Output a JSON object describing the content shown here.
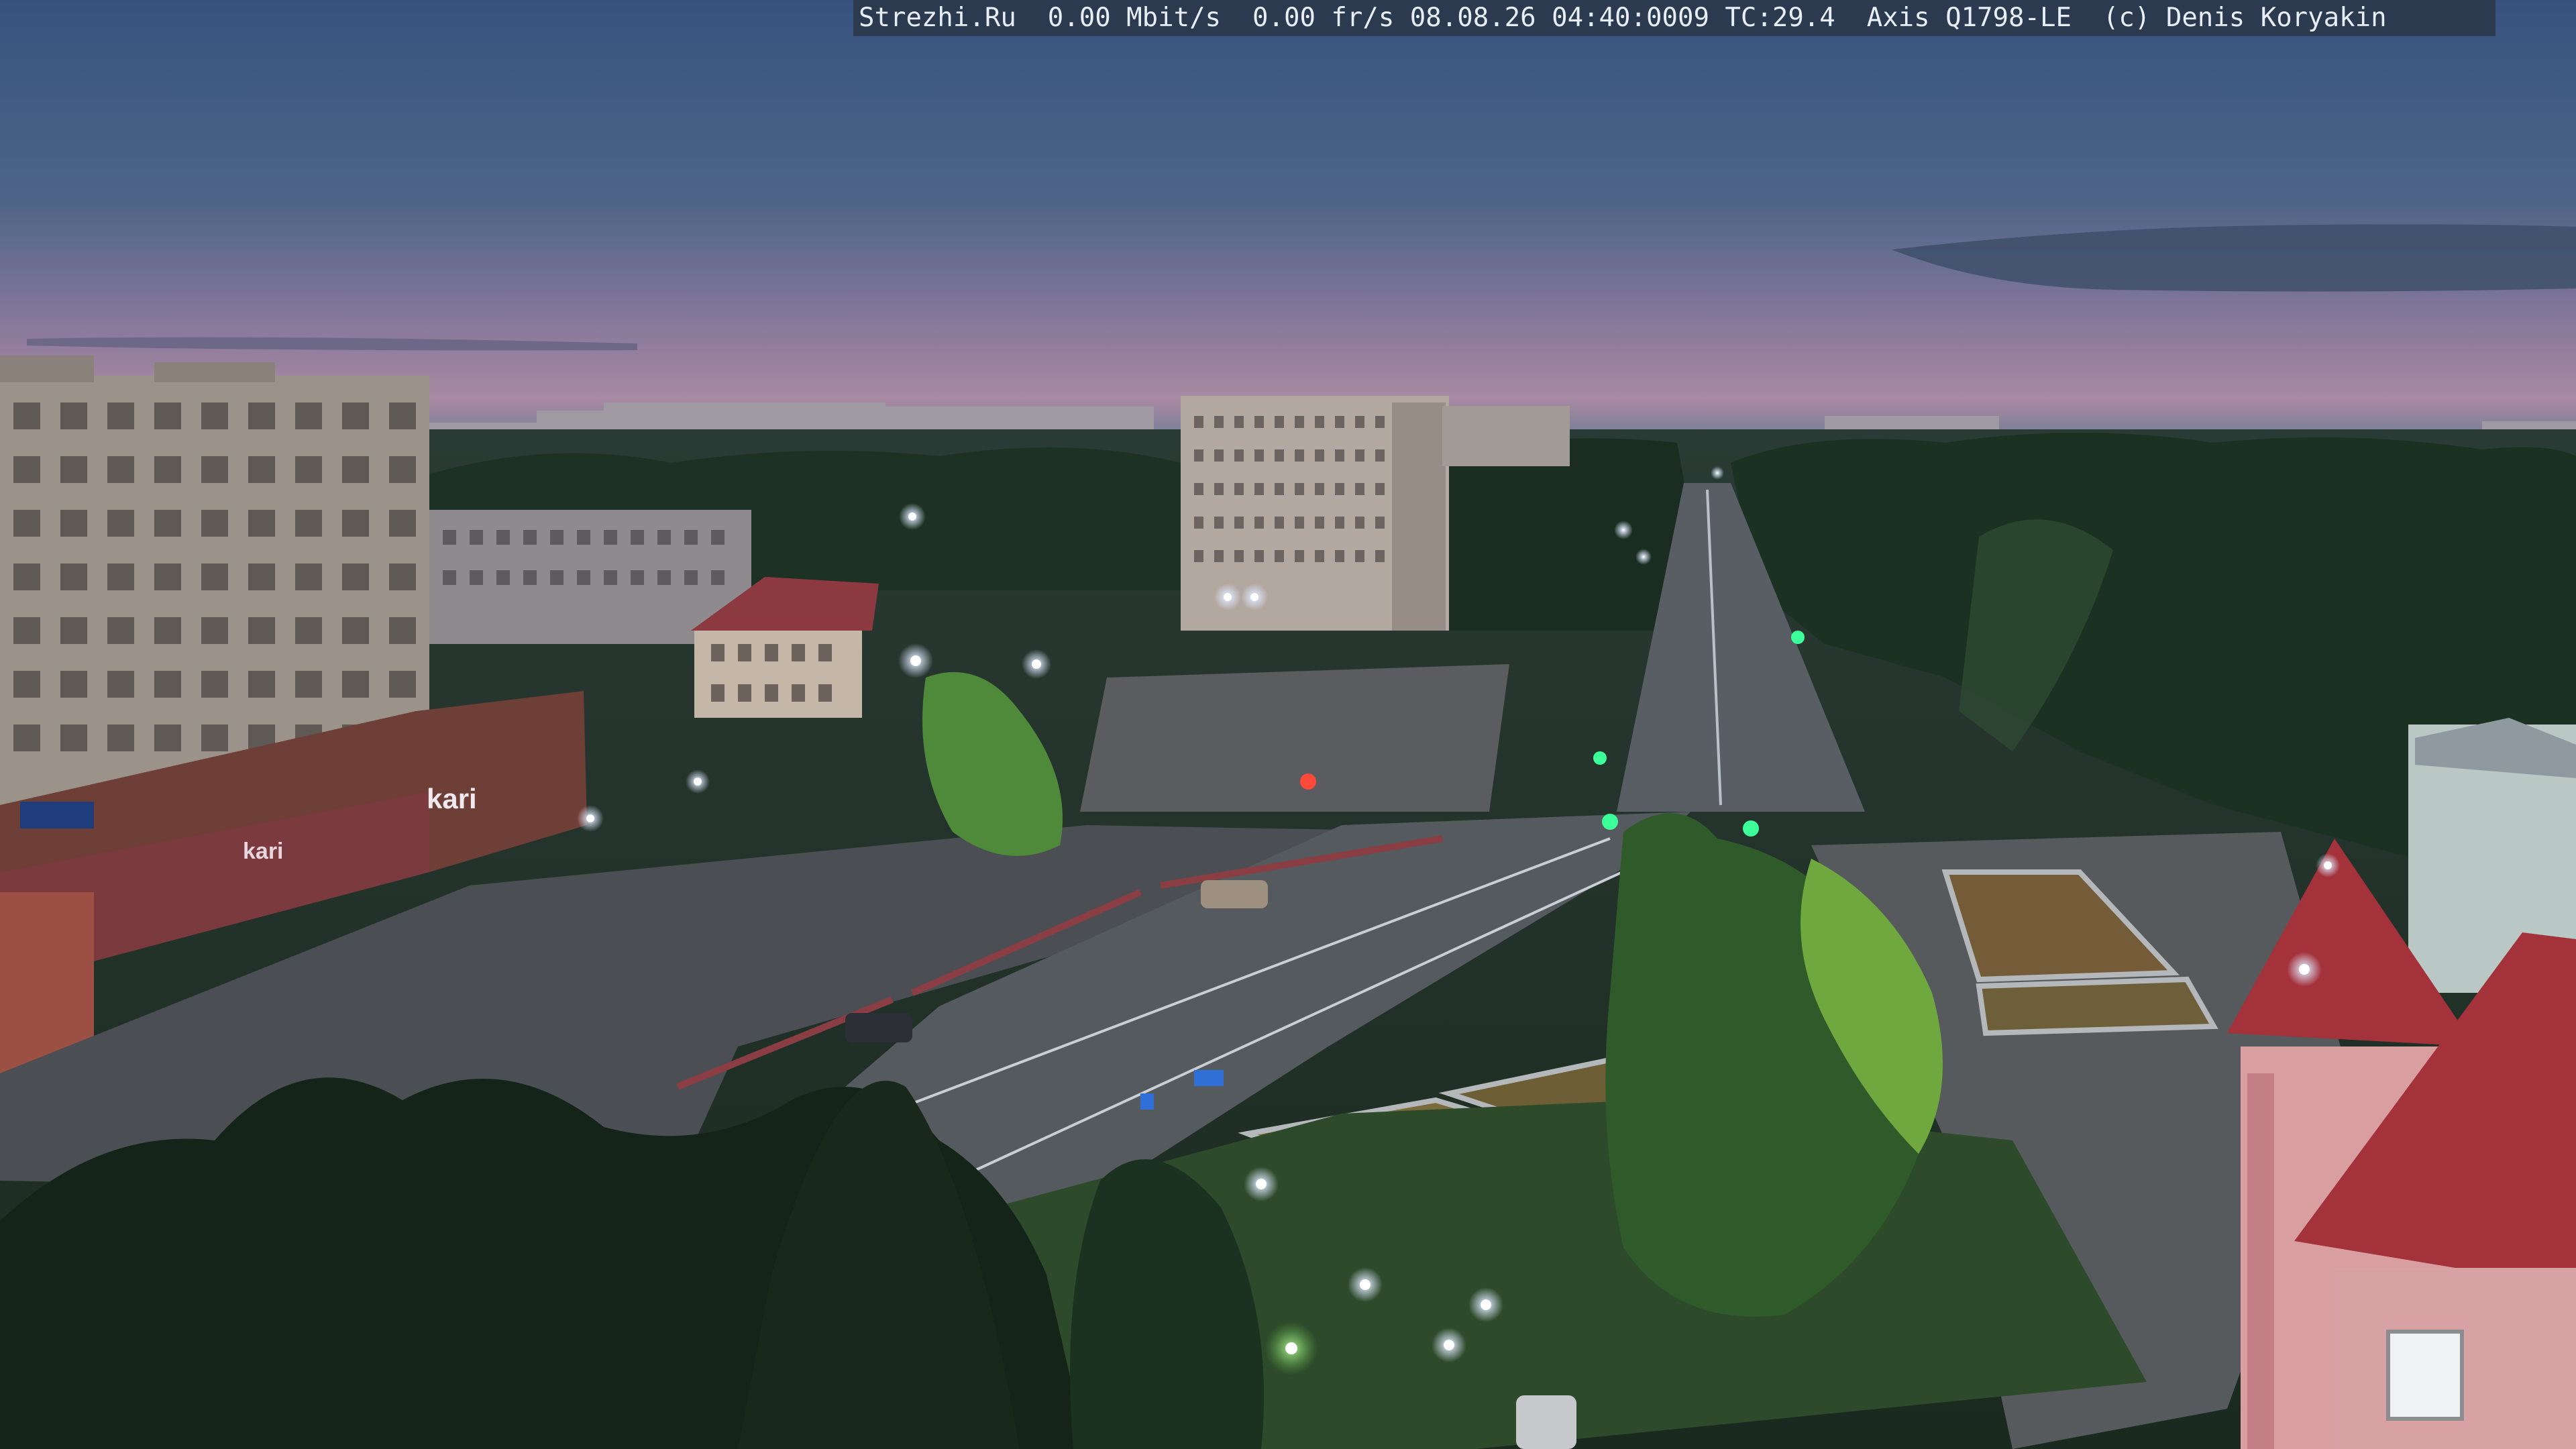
{
  "overlay": {
    "text": "Strezhi.Ru  0.00 Mbit/s  0.00 fr/s 08.08.26 04:40:0009 TC:29.4  Axis Q1798-LE  (c) Denis Koryakin",
    "background": "#2b3a4e",
    "color": "#e8eef6"
  },
  "scene": {
    "sky_top": "#3f5c86",
    "sky_horizon": "#b08aa3",
    "vegetation": "#1f3523",
    "road": "#4a4f55",
    "streetlight": "#eaf2ff",
    "signs": {
      "left_building": "kari",
      "left_building_sub": "kari"
    }
  }
}
